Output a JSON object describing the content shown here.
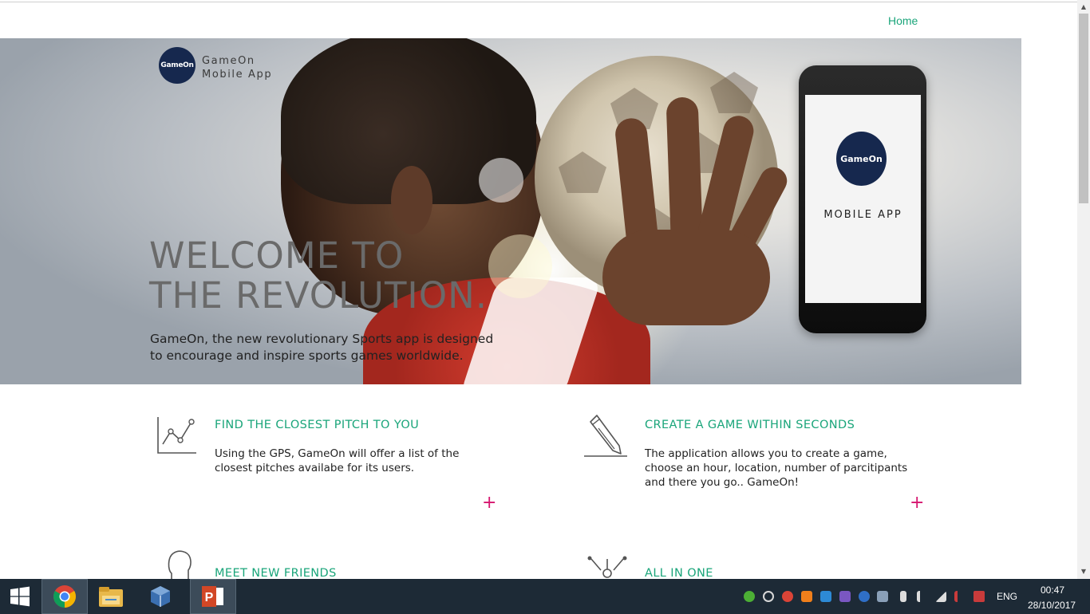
{
  "nav": {
    "home": "Home"
  },
  "brand": {
    "logo_text": "GameOn",
    "line1": "GameOn",
    "line2": "Mobile App"
  },
  "hero": {
    "headline_line1": "WELCOME TO",
    "headline_line2": "THE REVOLUTION.",
    "subtext": "GameOn, the new revolutionary Sports app is designed to encourage and inspire sports games worldwide."
  },
  "phone": {
    "logo_text": "GameOn",
    "label": "MOBILE APP"
  },
  "features": [
    {
      "title": "FIND THE CLOSEST PITCH TO YOU",
      "desc": "Using the GPS, GameOn will offer a list of the closest pitches availabe for its users.",
      "icon": "chart-icon",
      "plus": "+"
    },
    {
      "title": "CREATE A GAME WITHIN SECONDS",
      "desc": "The application allows you to create a game, choose an hour, location, number of parcitipants and there you go.. GameOn!",
      "icon": "pencil-icon",
      "plus": "+"
    },
    {
      "title": "MEET NEW FRIENDS",
      "icon": "head-icon"
    },
    {
      "title": "ALL IN ONE",
      "icon": "network-icon"
    }
  ],
  "taskbar": {
    "apps": [
      "start-icon",
      "chrome-icon",
      "file-explorer-icon",
      "virtualbox-icon",
      "powerpoint-icon"
    ],
    "language": "ENG",
    "time": "00:47",
    "date": "28/10/2017"
  },
  "colors": {
    "accent": "#1aa57a",
    "plus": "#d6166f",
    "navy": "#16284e",
    "taskbar": "#1d2a36"
  }
}
